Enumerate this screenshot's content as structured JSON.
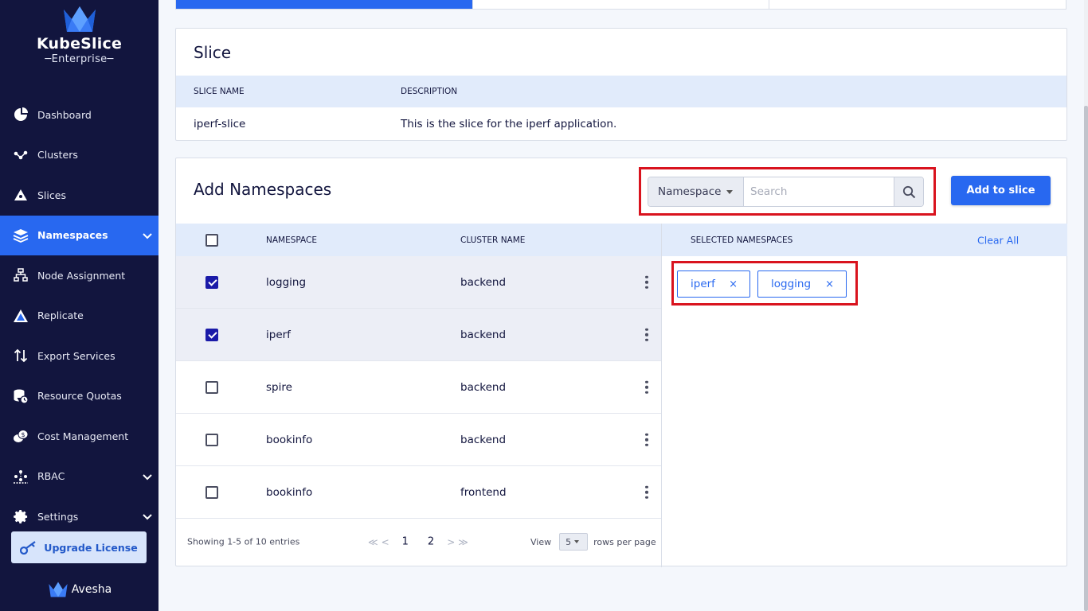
{
  "app": {
    "brand": "KubeSlice",
    "edition": "Enterprise",
    "footer_brand": "Avesha"
  },
  "sidebar": {
    "items": [
      {
        "label": "Dashboard",
        "icon": "pie-chart-icon"
      },
      {
        "label": "Clusters",
        "icon": "clusters-icon"
      },
      {
        "label": "Slices",
        "icon": "slices-icon"
      },
      {
        "label": "Namespaces",
        "icon": "layers-icon",
        "active": true
      },
      {
        "label": "Node Assignment",
        "icon": "node-tree-icon"
      },
      {
        "label": "Replicate",
        "icon": "replicate-icon"
      },
      {
        "label": "Export Services",
        "icon": "up-down-arrows-icon"
      },
      {
        "label": "Resource Quotas",
        "icon": "database-clock-icon"
      },
      {
        "label": "Cost Management",
        "icon": "coins-icon"
      },
      {
        "label": "RBAC",
        "icon": "rbac-users-icon"
      },
      {
        "label": "Settings",
        "icon": "gear-icon"
      }
    ],
    "upgrade_label": "Upgrade License"
  },
  "slice": {
    "title": "Slice",
    "col_name": "SLICE NAME",
    "col_desc": "DESCRIPTION",
    "name": "iperf-slice",
    "description": "This is the slice for the iperf application."
  },
  "namespaces": {
    "title": "Add Namespaces",
    "filter_label": "Namespace",
    "search_placeholder": "Search",
    "add_button": "Add to slice",
    "col_checkbox": "",
    "col_namespace": "NAMESPACE",
    "col_cluster": "CLUSTER NAME",
    "rows": [
      {
        "namespace": "logging",
        "cluster": "backend",
        "checked": true
      },
      {
        "namespace": "iperf",
        "cluster": "backend",
        "checked": true
      },
      {
        "namespace": "spire",
        "cluster": "backend",
        "checked": false
      },
      {
        "namespace": "bookinfo",
        "cluster": "backend",
        "checked": false
      },
      {
        "namespace": "bookinfo",
        "cluster": "frontend",
        "checked": false
      }
    ],
    "selected_header": "SELECTED NAMESPACES",
    "clear_all": "Clear All",
    "selected": [
      "iperf",
      "logging"
    ],
    "footer": {
      "showing": "Showing 1-5 of 10 entries",
      "first": "≪",
      "prev": "<",
      "pages": [
        "1",
        "2"
      ],
      "next": ">",
      "last": "≫",
      "view_label": "View",
      "rows_per_page": "5",
      "rows_label": "rows per page"
    }
  },
  "colors": {
    "sidebar_bg": "#12153e",
    "accent": "#2868f0",
    "highlight": "#d9131e",
    "table_head": "#e1ebfb"
  }
}
